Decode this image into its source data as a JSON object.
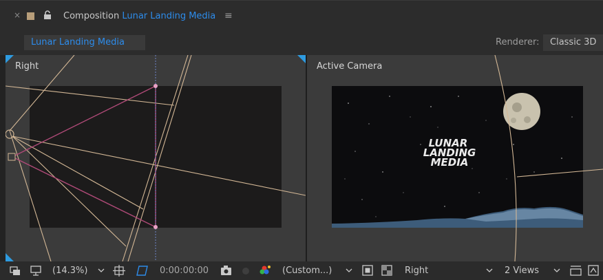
{
  "panel": {
    "close_glyph": "×",
    "title_prefix": "Composition",
    "title_comp": "Lunar Landing Media",
    "menu_glyph": "≡",
    "comp_tab": "Lunar Landing Media",
    "renderer_label": "Renderer:",
    "renderer_value": "Classic 3D",
    "accent_color": "#2d8ceb"
  },
  "views": {
    "left_label": "Right",
    "right_label": "Active Camera",
    "title_art": [
      "LUNAR",
      "LANDING",
      "MEDIA"
    ]
  },
  "toolbar": {
    "zoom": "(14.3%)",
    "timecode": "0:00:00:00",
    "resolution": "(Custom...)",
    "view_name": "Right",
    "layout": "2 Views",
    "icons": [
      "always-preview-icon",
      "monitor-icon",
      "region-of-interest-icon",
      "transparency-grid-icon",
      "snapshot-icon",
      "show-snapshot-icon",
      "color-wheel-icon",
      "fast-preview-icon",
      "toggle-grid-icon",
      "layout-share-icon",
      "reset-exposure-icon"
    ]
  }
}
